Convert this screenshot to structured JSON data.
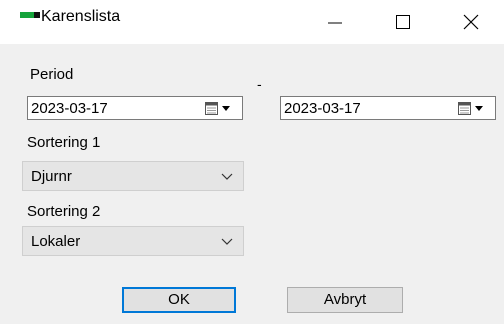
{
  "window": {
    "title": "Karenslista",
    "icon": "app-icon",
    "controls": [
      "minimize-icon",
      "maximize-icon",
      "close-icon"
    ]
  },
  "period": {
    "label": "Period",
    "separator": "-",
    "from_date": "2023-03-17",
    "to_date": "2023-03-17"
  },
  "sort1": {
    "label": "Sortering 1",
    "value": "Djurnr"
  },
  "sort2": {
    "label": "Sortering 2",
    "value": "Lokaler"
  },
  "buttons": {
    "ok": "OK",
    "cancel": "Avbryt"
  },
  "colors": {
    "accent": "#0078d7",
    "icon_green": "#15a33b"
  }
}
